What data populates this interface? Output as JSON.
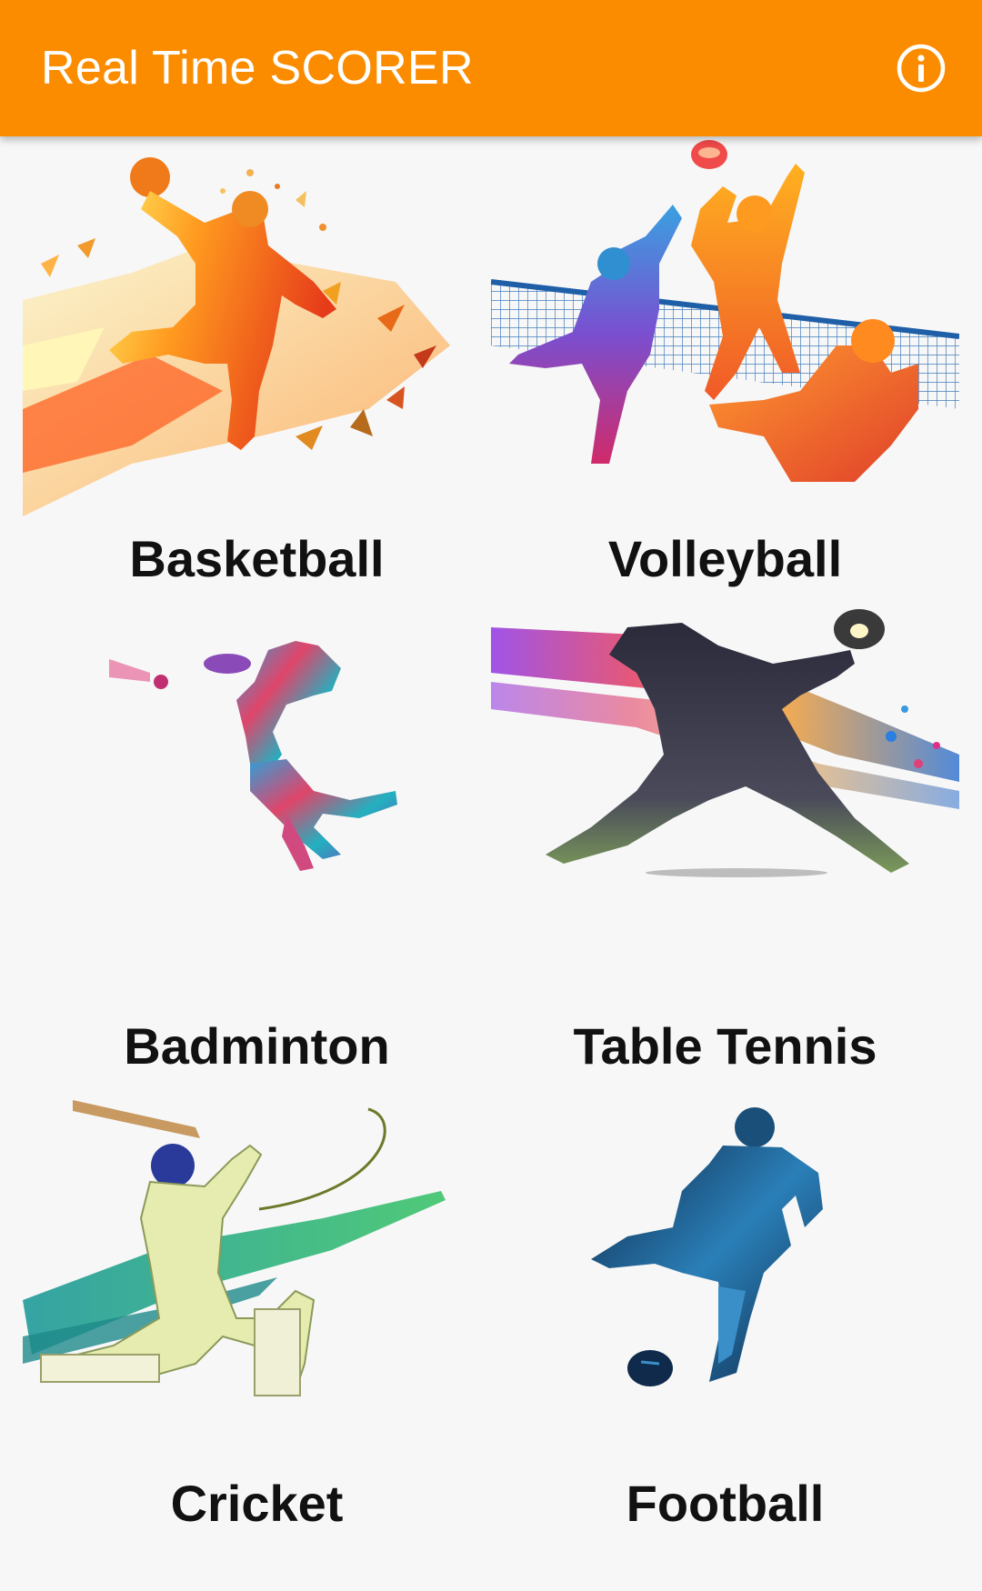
{
  "app_bar": {
    "title": "Real Time SCORER",
    "background": "#fb8c00",
    "info_icon": "info-circle-icon"
  },
  "sports": [
    {
      "label": "Basketball",
      "image": "basketball-player-image"
    },
    {
      "label": "Volleyball",
      "image": "volleyball-players-image"
    },
    {
      "label": "Badminton",
      "image": "badminton-player-image"
    },
    {
      "label": "Table Tennis",
      "image": "table-tennis-player-image"
    },
    {
      "label": "Cricket",
      "image": "cricket-batsman-image"
    },
    {
      "label": "Football",
      "image": "football-player-image"
    }
  ]
}
